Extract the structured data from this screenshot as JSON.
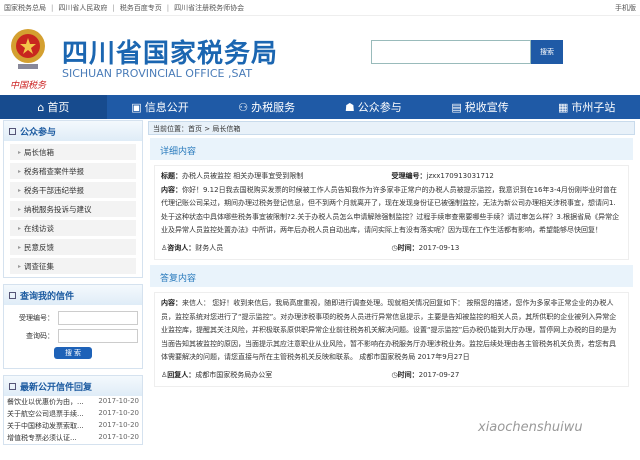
{
  "topbar": {
    "links": [
      "国家税务总局",
      "四川省人民政府",
      "税务百度专页",
      "四川省注册税务师协会"
    ],
    "mobile": "手机版"
  },
  "header": {
    "title": "四川省国家税务局",
    "subtitle": "SICHUAN PROVINCIAL OFFICE ,SAT",
    "seal": "中国税务",
    "search_button": "搜索",
    "search_value": ""
  },
  "nav": [
    {
      "icon": "home-icon",
      "glyph": "⌂",
      "label": "首页"
    },
    {
      "icon": "info-icon",
      "glyph": "▣",
      "label": "信息公开"
    },
    {
      "icon": "service-icon",
      "glyph": "⚇",
      "label": "办税服务"
    },
    {
      "icon": "people-icon",
      "glyph": "☗",
      "label": "公众参与"
    },
    {
      "icon": "doc-icon",
      "glyph": "▤",
      "label": "税收宣传"
    },
    {
      "icon": "grid-icon",
      "glyph": "▦",
      "label": "市州子站"
    }
  ],
  "sidebar": {
    "participation": {
      "title": "公众参与",
      "items": [
        "局长信箱",
        "税务稽查案件举报",
        "税务干部违纪举报",
        "纳税服务投诉与建议",
        "在线访谈",
        "民意反馈",
        "调查征集"
      ]
    },
    "query": {
      "title": "查询我的信件",
      "id_label": "受理编号：",
      "code_label": "查询码：",
      "button": "搜 索"
    },
    "latest": {
      "title": "最新公开信件回复",
      "items": [
        {
          "t": "餐饮业以优惠价为由，...",
          "d": "2017-10-20"
        },
        {
          "t": "关于航空公司退票手续...",
          "d": "2017-10-20"
        },
        {
          "t": "关于中国移动发票索取...",
          "d": "2017-10-20"
        },
        {
          "t": "增值税专票必须认证...",
          "d": "2017-10-20"
        }
      ]
    }
  },
  "main": {
    "breadcrumb": "当前位置：首页 > 局长信箱",
    "detail": {
      "heading": "详细内容",
      "title_label": "标题：",
      "title": "办税人员被监控 相关办理事宜受到限制",
      "id_label": "受理编号：",
      "id": "jzxx170913031712",
      "content_label": "内容：",
      "content": "你好！9.12日我去国税购买发票的时候被工作人员告知我作为许多家非正常户的办税人员被提示监控，我意识到在16年3-4月份刚毕业时曾在代理记账公司呆过，期间办理过税务登记信息，但不到两个月就离开了，现在发现身份证已被强制监控，无法为新公司办理相关涉税事宜，想请问1.处于这种状态中具体哪些税务事宜被限制?2.关于办税人员怎么申请解除强制监控？过程手续审查需要哪些手续？请过审怎么样？3.根据省局《异常企业及异常人员监控处置办法》中所讲，两年后办税人员自动出库，请问实际上有没有落实呢？因为现在工作生活都有影响，希望能够尽快回复！",
      "asker_label": "咨询人：",
      "asker": "财务人员",
      "time_label": "时间：",
      "time": "2017-09-13"
    },
    "reply": {
      "heading": "答复内容",
      "content_label": "内容：",
      "content": "来信人： 您好！收到来信后，我局高度重视，随即进行调查处理。现就相关情况回复如下： 按照您的描述，您作为多家非正常企业的办税人员，监控系统对您进行了“提示监控”。对办理涉税事项的税务人员进行异常信息提示，主要是告知被监控的相关人员，其所供职的企业被列入异常企业监控库，提醒其关注风险，并积极联系原供职异常企业前往税务机关解决问题。设置“提示监控”后办税仍能到大厅办理，暂停网上办税的目的是为当面告知其被监控的原因，当面提示其应注意职业从业风险，暂不影响在办税服务厅办理涉税业务。监控后续处理由各主管税务机关负责，若您有具体需要解决的问题，请您直接与所在主管税务机关反映和联系。 成都市国家税务局 2017年9月27日",
      "replier_label": "回复人：",
      "replier": "成都市国家税务局办公室",
      "time_label": "时间：",
      "time": "2017-09-27"
    }
  },
  "watermark": "xiaochenshuiwu"
}
